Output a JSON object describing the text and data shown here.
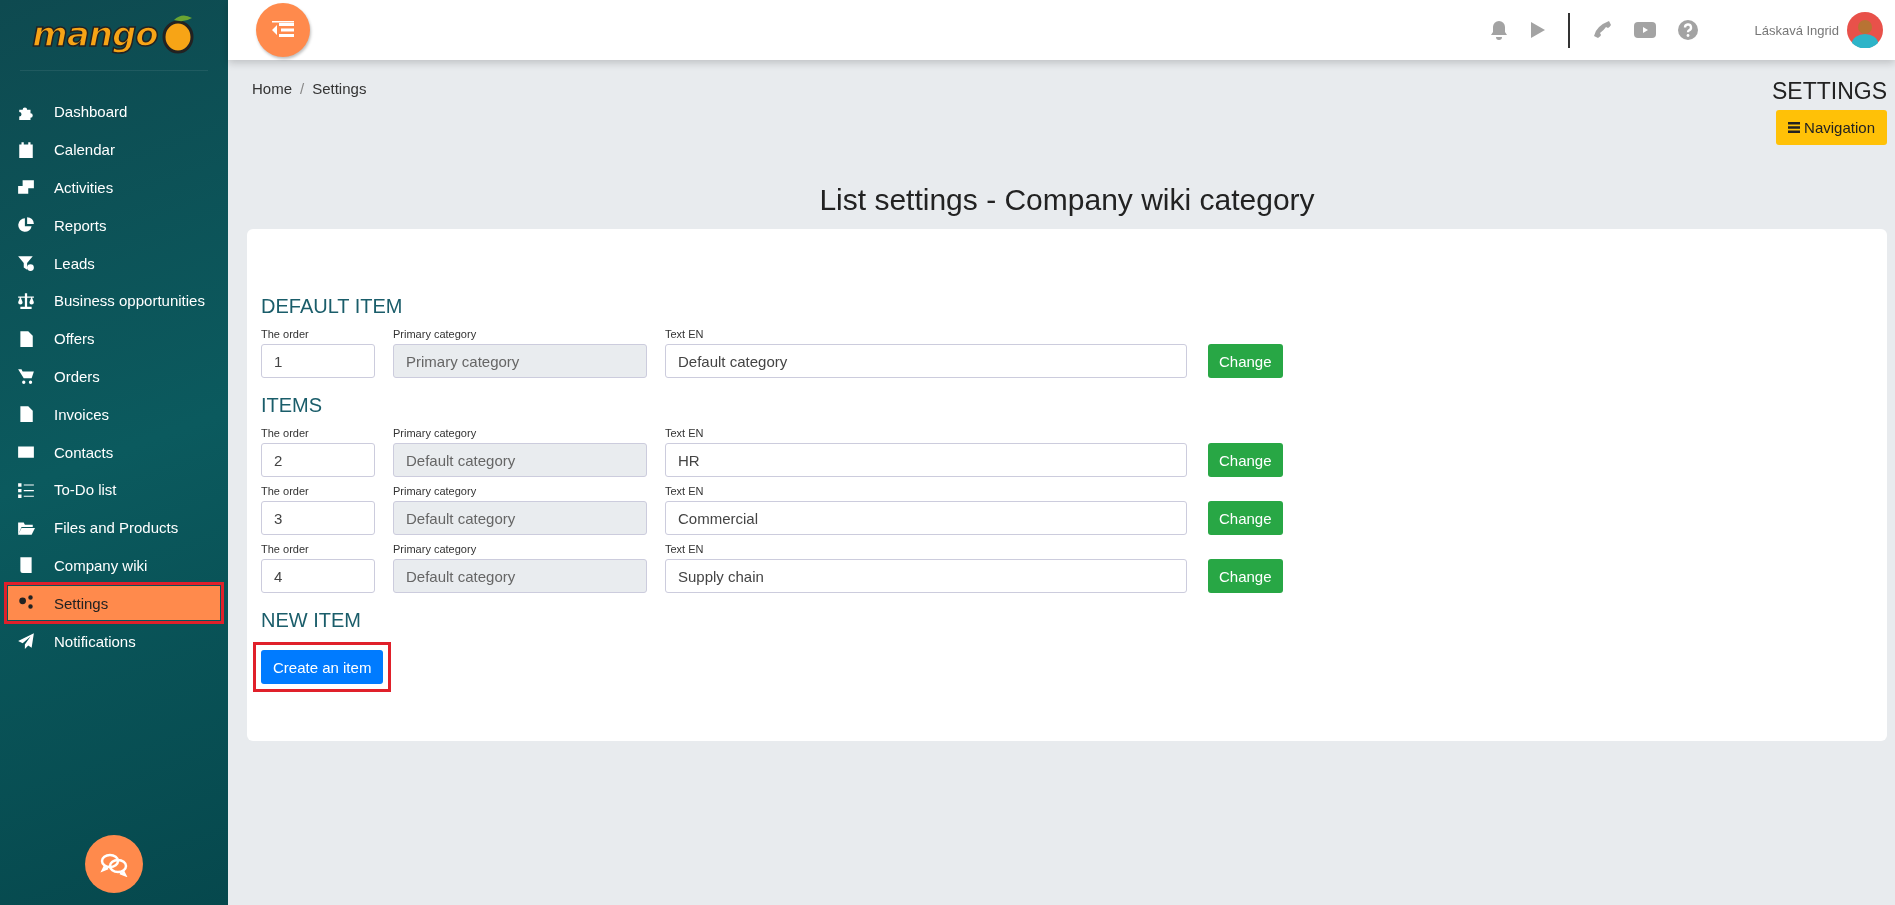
{
  "sidebar": {
    "logo": "mango",
    "items": [
      {
        "label": "Dashboard",
        "selected": false,
        "highlighted": false
      },
      {
        "label": "Calendar",
        "selected": false,
        "highlighted": false
      },
      {
        "label": "Activities",
        "selected": false,
        "highlighted": false
      },
      {
        "label": "Reports",
        "selected": false,
        "highlighted": false
      },
      {
        "label": "Leads",
        "selected": false,
        "highlighted": false
      },
      {
        "label": "Business opportunities",
        "selected": false,
        "highlighted": false
      },
      {
        "label": "Offers",
        "selected": false,
        "highlighted": false
      },
      {
        "label": "Orders",
        "selected": false,
        "highlighted": false
      },
      {
        "label": "Invoices",
        "selected": false,
        "highlighted": false
      },
      {
        "label": "Contacts",
        "selected": false,
        "highlighted": false
      },
      {
        "label": "To-Do list",
        "selected": false,
        "highlighted": false
      },
      {
        "label": "Files and Products",
        "selected": false,
        "highlighted": false
      },
      {
        "label": "Company wiki",
        "selected": false,
        "highlighted": false
      },
      {
        "label": "Settings",
        "selected": true,
        "highlighted": true
      },
      {
        "label": "Notifications",
        "selected": false,
        "highlighted": false
      }
    ]
  },
  "topbar": {
    "user_name": "Láskavá Ingrid"
  },
  "breadcrumb": {
    "separator": "/",
    "items": [
      "Home",
      "Settings"
    ]
  },
  "page_heading": "SETTINGS",
  "navigation_button": "Navigation",
  "card": {
    "title": "List settings - Company wiki category",
    "sections": [
      {
        "heading": "DEFAULT ITEM",
        "rows": [
          {
            "fields": [
              {
                "label": "The order",
                "value": "1",
                "disabled": false
              },
              {
                "label": "Primary category",
                "value": "Primary category",
                "disabled": true
              },
              {
                "label": "Text EN",
                "value": "Default category",
                "disabled": false
              }
            ],
            "button": "Change"
          }
        ]
      },
      {
        "heading": "ITEMS",
        "rows": [
          {
            "fields": [
              {
                "label": "The order",
                "value": "2",
                "disabled": false
              },
              {
                "label": "Primary category",
                "value": "Default category",
                "disabled": true
              },
              {
                "label": "Text EN",
                "value": "HR",
                "disabled": false
              }
            ],
            "button": "Change"
          },
          {
            "fields": [
              {
                "label": "The order",
                "value": "3",
                "disabled": false
              },
              {
                "label": "Primary category",
                "value": "Default category",
                "disabled": true
              },
              {
                "label": "Text EN",
                "value": "Commercial",
                "disabled": false
              }
            ],
            "button": "Change"
          },
          {
            "fields": [
              {
                "label": "The order",
                "value": "4",
                "disabled": false
              },
              {
                "label": "Primary category",
                "value": "Default category",
                "disabled": true
              },
              {
                "label": "Text EN",
                "value": "Supply chain",
                "disabled": false
              }
            ],
            "button": "Change"
          }
        ]
      }
    ],
    "new_item": {
      "heading": "NEW ITEM",
      "button": "Create an item",
      "highlighted": true
    }
  }
}
